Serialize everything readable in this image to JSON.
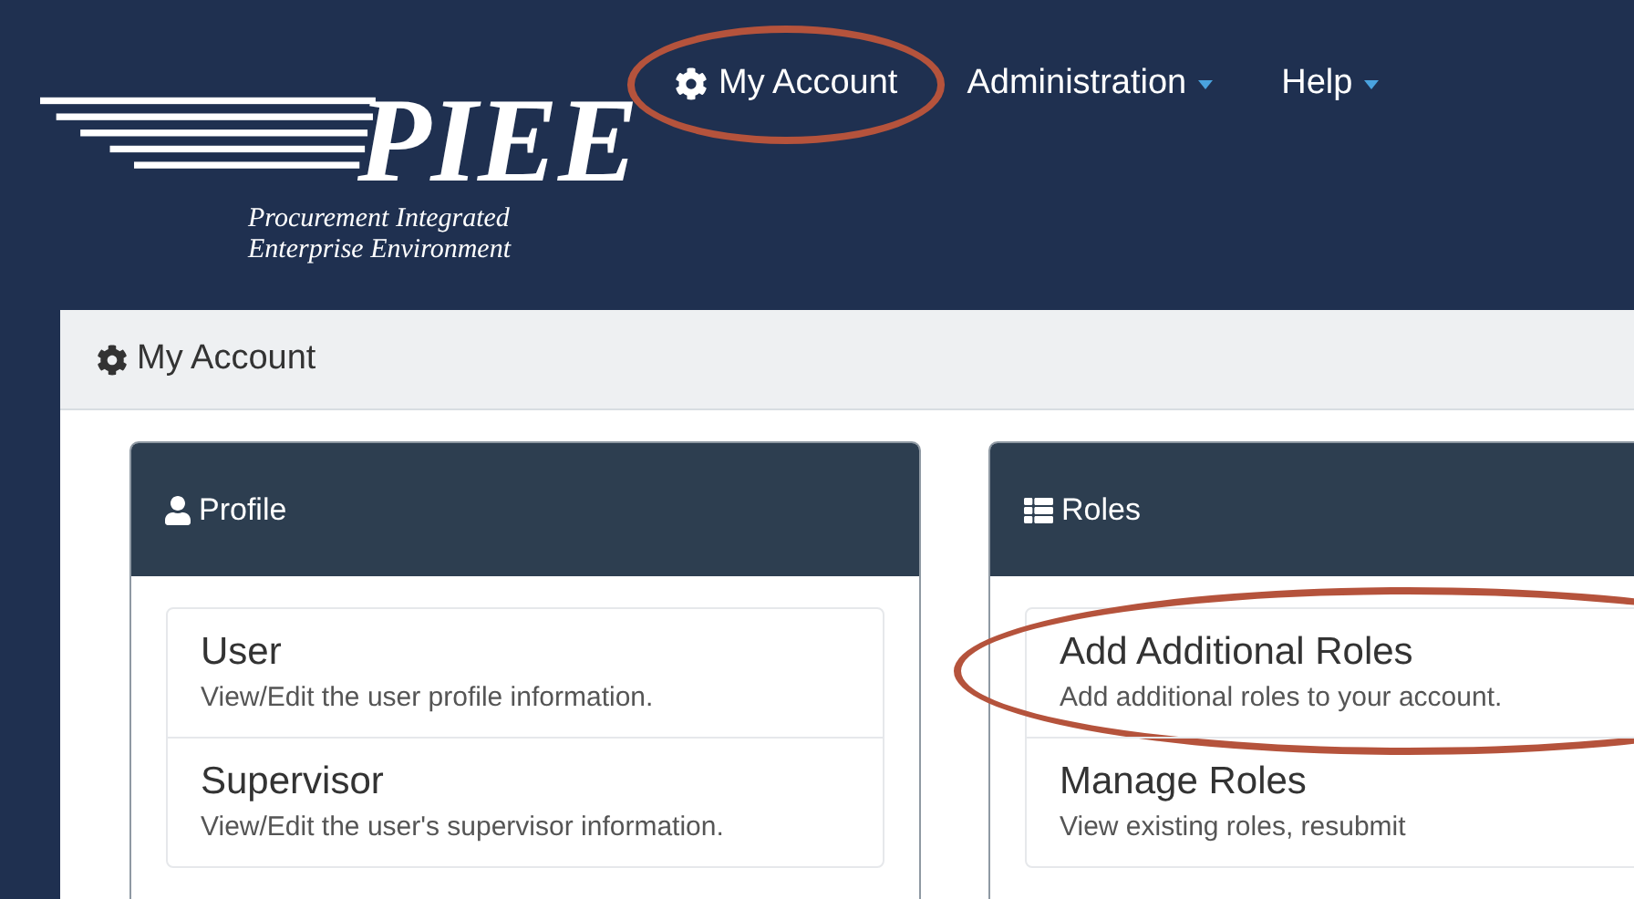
{
  "logo": {
    "name": "PIEE",
    "subtitle_lines": [
      "Procurement Integrated",
      "Enterprise Environment"
    ]
  },
  "nav": [
    {
      "label": "My Account",
      "kind": "gear",
      "circled": true
    },
    {
      "label": "Administration",
      "kind": "dropdown",
      "circled": false
    },
    {
      "label": "Help",
      "kind": "dropdown",
      "circled": false
    }
  ],
  "page_header": {
    "title": "My Account"
  },
  "cards": [
    {
      "title": "Profile",
      "kind": "user",
      "items": [
        {
          "title": "User",
          "description": "View/Edit the user profile information.",
          "circled": false
        },
        {
          "title": "Supervisor",
          "description": "View/Edit the user's supervisor information.",
          "circled": false
        }
      ]
    },
    {
      "title": "Roles",
      "kind": "list",
      "items": [
        {
          "title": "Add Additional Roles",
          "description": "Add additional roles to your account.",
          "circled": true
        },
        {
          "title": "Manage Roles",
          "description": "View existing roles, resubmit",
          "circled": false
        }
      ]
    }
  ]
}
